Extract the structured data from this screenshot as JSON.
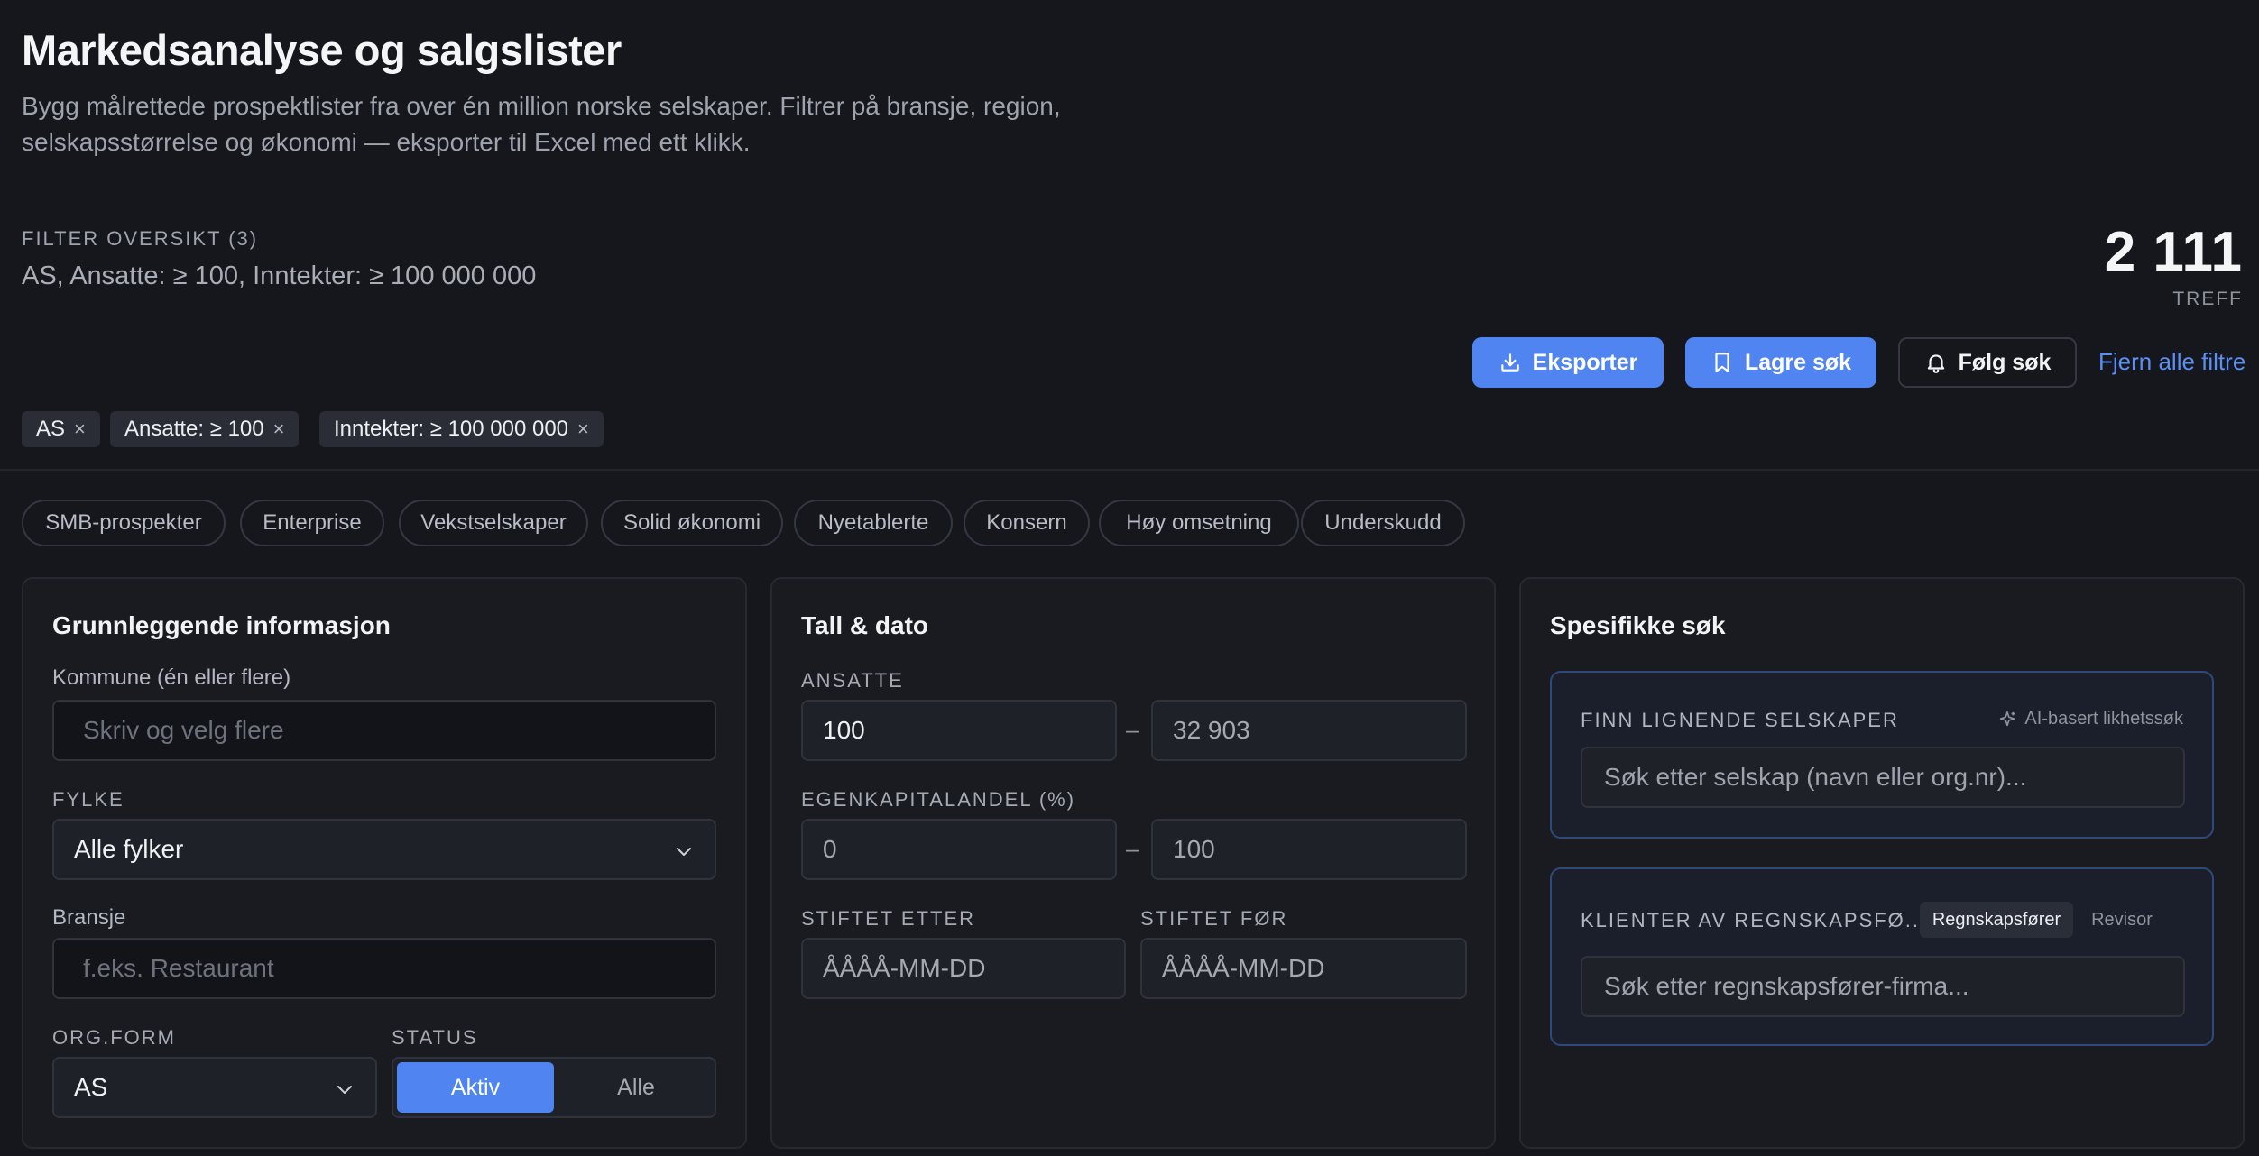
{
  "header": {
    "title": "Markedsanalyse og salgslister",
    "subtitle": "Bygg målrettede prospektlister fra over én million norske selskaper. Filtrer på bransje, region, selskapsstørrelse og økonomi — eksporter til Excel med ett klikk."
  },
  "filter_overview": {
    "label": "FILTER OVERSIKT (3)",
    "summary": "AS, Ansatte: ≥ 100, Inntekter: ≥ 100 000 000",
    "hits_count": "2 111",
    "hits_label": "TREFF"
  },
  "actions": {
    "export": "Eksporter",
    "save": "Lagre søk",
    "follow": "Følg søk",
    "clear_all": "Fjern alle filtre"
  },
  "active_filters": [
    {
      "label": "AS"
    },
    {
      "label": "Ansatte: ≥ 100"
    },
    {
      "label": "Inntekter: ≥ 100 000 000"
    }
  ],
  "presets": [
    "SMB-prospekter",
    "Enterprise",
    "Vekstselskaper",
    "Solid økonomi",
    "Nyetablerte",
    "Konsern",
    "Høy omsetning",
    "Underskudd"
  ],
  "basic_info": {
    "title": "Grunnleggende informasjon",
    "kommune_label": "Kommune (én eller flere)",
    "kommune_placeholder": "Skriv og velg flere",
    "fylke_label": "FYLKE",
    "fylke_value": "Alle fylker",
    "bransje_label": "Bransje",
    "bransje_placeholder": "f.eks. Restaurant",
    "orgform_label": "ORG.FORM",
    "orgform_value": "AS",
    "status_label": "STATUS",
    "status_active": "Aktiv",
    "status_all": "Alle"
  },
  "numbers": {
    "title": "Tall & dato",
    "ansatte_label": "ANSATTE",
    "ansatte_min": "100",
    "ansatte_max": "32 903",
    "egenkapital_label": "EGENKAPITALANDEL (%)",
    "egenkapital_min": "0",
    "egenkapital_max": "100",
    "stiftet_etter_label": "STIFTET ETTER",
    "stiftet_for_label": "STIFTET FØR",
    "date_placeholder": "ÅÅÅÅ-MM-DD",
    "range_separator": "–"
  },
  "specific": {
    "title": "Spesifikke søk",
    "similar_label": "FINN LIGNENDE SELSKAPER",
    "similar_hint": "AI-basert likhetssøk",
    "similar_placeholder": "Søk etter selskap (navn eller org.nr)...",
    "clients_label": "KLIENTER AV REGNSKAPSFØ...",
    "clients_toggle_on": "Regnskapsfører",
    "clients_toggle_off": "Revisor",
    "clients_placeholder": "Søk etter regnskapsfører-firma..."
  },
  "colors": {
    "background": "#15171c",
    "accent": "#4f84f1",
    "link": "#5b8ff5",
    "card": "#191b21",
    "sub_card_border": "#2f4a7a"
  }
}
